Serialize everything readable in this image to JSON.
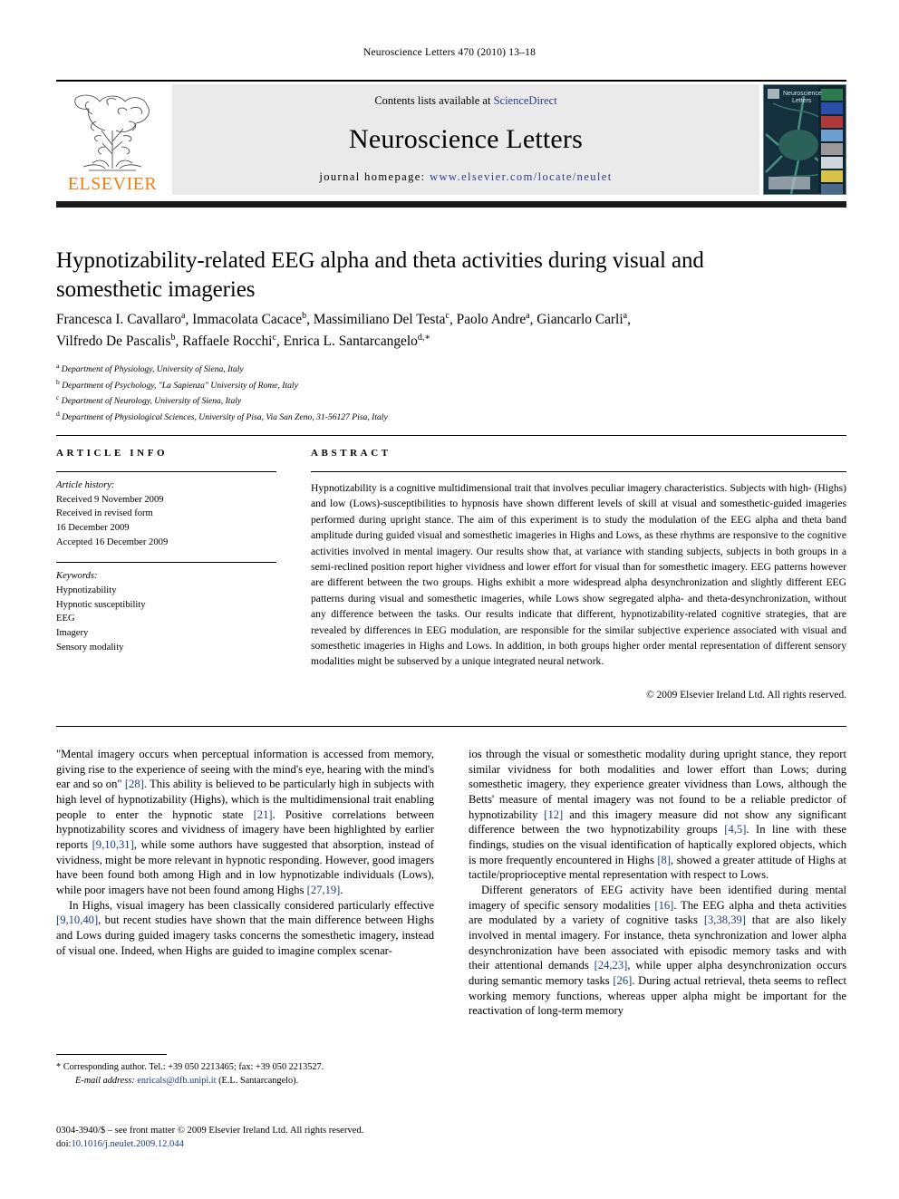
{
  "running_head": "Neuroscience Letters 470 (2010) 13–18",
  "masthead": {
    "publisher": "ELSEVIER",
    "contents_prefix": "Contents lists available at ",
    "contents_link": "ScienceDirect",
    "journal_name": "Neuroscience Letters",
    "homepage_prefix": "journal homepage: ",
    "homepage_url": "www.elsevier.com/locate/neulet",
    "cover_title_line1": "Neuroscience",
    "cover_title_line2": "Letters"
  },
  "article": {
    "title": "Hypnotizability-related EEG alpha and theta activities during visual and somesthetic imageries",
    "authors_line1": "Francesca I. Cavallaro<sup>a</sup>, Immacolata Cacace<sup>b</sup>, Massimiliano Del Testa<sup>c</sup>, Paolo Andre<sup>a</sup>, Giancarlo Carli<sup>a</sup>,",
    "authors_line2": "Vilfredo De Pascalis<sup>b</sup>, Raffaele Rocchi<sup>c</sup>, Enrica L. Santarcangelo<sup>d,</sup><sup>∗</sup>",
    "affiliations": [
      "<sup>a</sup> Department of Physiology, University of Siena, Italy",
      "<sup>b</sup> Department of Psychology, \"La Sapienza\" University of Rome, Italy",
      "<sup>c</sup> Department of Neurology, University of Siena, Italy",
      "<sup>d</sup> Department of Physiological Sciences, University of Pisa, Via San Zeno, 31-56127 Pisa, Italy"
    ]
  },
  "article_info": {
    "heading": "ARTICLE INFO",
    "history_label": "Article history:",
    "history": [
      "Received 9 November 2009",
      "Received in revised form",
      "16 December 2009",
      "Accepted 16 December 2009"
    ],
    "keywords_label": "Keywords:",
    "keywords": [
      "Hypnotizability",
      "Hypnotic susceptibility",
      "EEG",
      "Imagery",
      "Sensory modality"
    ]
  },
  "abstract": {
    "heading": "ABSTRACT",
    "text": "Hypnotizability is a cognitive multidimensional trait that involves peculiar imagery characteristics. Subjects with high- (Highs) and low (Lows)-susceptibilities to hypnosis have shown different levels of skill at visual and somesthetic-guided imageries performed during upright stance. The aim of this experiment is to study the modulation of the EEG alpha and theta band amplitude during guided visual and somesthetic imageries in Highs and Lows, as these rhythms are responsive to the cognitive activities involved in mental imagery. Our results show that, at variance with standing subjects, subjects in both groups in a semi-reclined position report higher vividness and lower effort for visual than for somesthetic imagery. EEG patterns however are different between the two groups. Highs exhibit a more widespread alpha desynchronization and slightly different EEG patterns during visual and somesthetic imageries, while Lows show segregated alpha- and theta-desynchronization, without any difference between the tasks. Our results indicate that different, hypnotizability-related cognitive strategies, that are revealed by differences in EEG modulation, are responsible for the similar subjective experience associated with visual and somesthetic imageries in Highs and Lows. In addition, in both groups higher order mental representation of different sensory modalities might be subserved by a unique integrated neural network.",
    "copyright": "© 2009 Elsevier Ireland Ltd. All rights reserved."
  },
  "body": {
    "left_paragraphs": [
      "\"Mental imagery occurs when perceptual information is accessed from memory, giving rise to the experience of seeing with the mind's eye, hearing with the mind's ear and so on\" <span class=\"ref\">[28]</span>. This ability is believed to be particularly high in subjects with high level of hypnotizability (Highs), which is the multidimensional trait enabling people to enter the hypnotic state <span class=\"ref\">[21]</span>. Positive correlations between hypnotizability scores and vividness of imagery have been highlighted by earlier reports <span class=\"ref\">[9,10,31]</span>, while some authors have suggested that absorption, instead of vividness, might be more relevant in hypnotic responding. However, good imagers have been found both among High and in low hypnotizable individuals (Lows), while poor imagers have not been found among Highs <span class=\"ref\">[27,19]</span>.",
      "In Highs, visual imagery has been classically considered particularly effective <span class=\"ref\">[9,10,40]</span>, but recent studies have shown that the main difference between Highs and Lows during guided imagery tasks concerns the somesthetic imagery, instead of visual one. Indeed, when Highs are guided to imagine complex scenar-"
    ],
    "right_paragraphs": [
      "ios through the visual or somesthetic modality during upright stance, they report similar vividness for both modalities and lower effort than Lows; during somesthetic imagery, they experience greater vividness than Lows, although the Betts' measure of mental imagery was not found to be a reliable predictor of hypnotizability <span class=\"ref\">[12]</span> and this imagery measure did not show any significant difference between the two hypnotizability groups <span class=\"ref\">[4,5]</span>. In line with these findings, studies on the visual identification of haptically explored objects, which is more frequently encountered in Highs <span class=\"ref\">[8]</span>, showed a greater attitude of Highs at tactile/proprioceptive mental representation with respect to Lows.",
      "Different generators of EEG activity have been identified during mental imagery of specific sensory modalities <span class=\"ref\">[16]</span>. The EEG alpha and theta activities are modulated by a variety of cognitive tasks <span class=\"ref\">[3,38,39]</span> that are also likely involved in mental imagery. For instance, theta synchronization and lower alpha desynchronization have been associated with episodic memory tasks and with their attentional demands <span class=\"ref\">[24,23]</span>, while upper alpha desynchronization occurs during semantic memory tasks <span class=\"ref\">[26]</span>. During actual retrieval, theta seems to reflect working memory functions, whereas upper alpha might be important for the reactivation of long-term memory"
    ]
  },
  "footnote": {
    "line1": "* Corresponding author. Tel.: +39 050 2213465; fax: +39 050 2213527.",
    "email_label": "E-mail address:",
    "email": "enricals@dfb.unipi.it",
    "email_suffix": "(E.L. Santarcangelo)."
  },
  "frontmatter": {
    "line1": "0304-3940/$ – see front matter © 2009 Elsevier Ireland Ltd. All rights reserved.",
    "doi_label": "doi:",
    "doi": "10.1016/j.neulet.2009.12.044"
  }
}
